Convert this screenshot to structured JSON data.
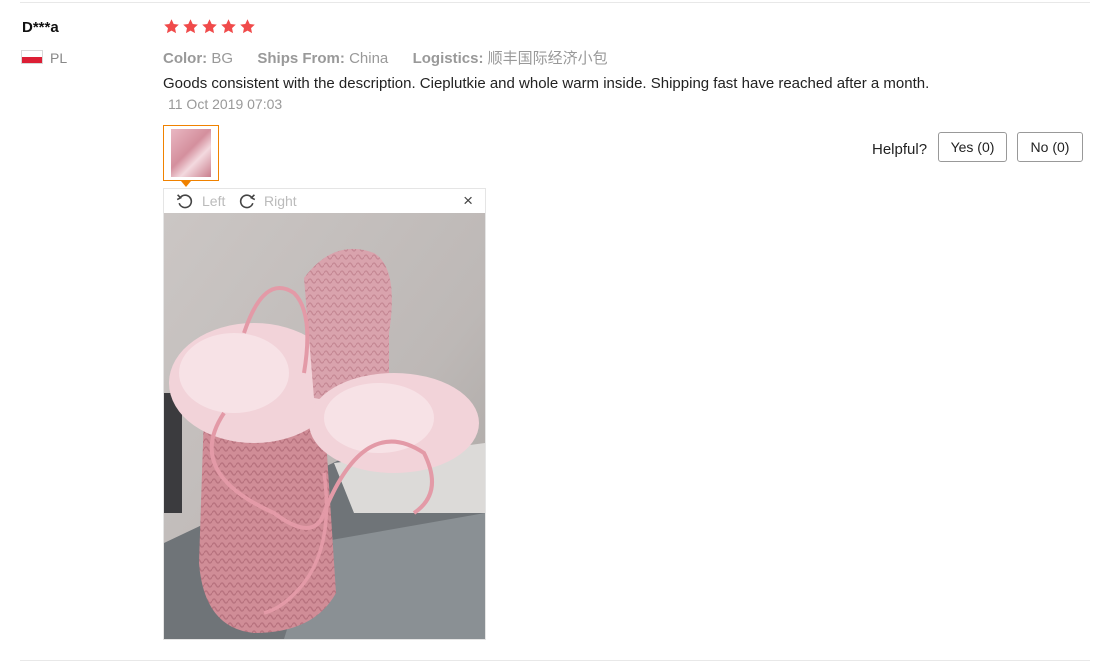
{
  "reviewer": {
    "name": "D***a",
    "country_code": "PL",
    "flag_colors": [
      "#ffffff",
      "#dc1e35"
    ]
  },
  "rating": {
    "stars": 5,
    "max": 5,
    "color": "#f04a4a"
  },
  "meta": {
    "color_label": "Color:",
    "color_value": "BG",
    "ships_label": "Ships From:",
    "ships_value": "China",
    "logistics_label": "Logistics:",
    "logistics_value": "顺丰国际经济小包"
  },
  "review": {
    "text": "Goods consistent with the description. Cieplutkie and whole warm inside. Shipping fast have reached after a month.",
    "date": "11 Oct 2019 07:03"
  },
  "helpful": {
    "label": "Helpful?",
    "yes_label": "Yes (0)",
    "no_label": "No (0)"
  },
  "viewer": {
    "rotate_left_label": "Left",
    "rotate_right_label": "Right",
    "close_glyph": "×",
    "accent_color": "#f08200"
  }
}
